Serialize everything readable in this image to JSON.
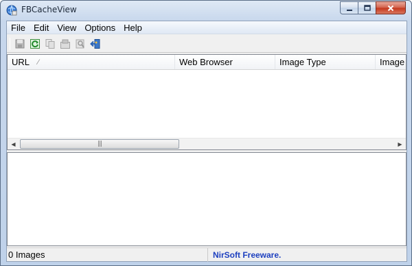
{
  "window": {
    "title": "FBCacheView",
    "icon": "app-globe-icon",
    "controls": {
      "minimize": "minimize-icon",
      "maximize": "maximize-icon",
      "close": "close-icon"
    }
  },
  "menu": {
    "items": [
      {
        "label": "File"
      },
      {
        "label": "Edit"
      },
      {
        "label": "View"
      },
      {
        "label": "Options"
      },
      {
        "label": "Help"
      }
    ]
  },
  "toolbar": {
    "buttons": [
      {
        "icon": "save-icon",
        "enabled": false
      },
      {
        "icon": "refresh-icon",
        "enabled": true
      },
      {
        "icon": "copy-icon",
        "enabled": false
      },
      {
        "icon": "properties-icon",
        "enabled": false
      },
      {
        "icon": "find-icon",
        "enabled": false
      },
      {
        "icon": "exit-icon",
        "enabled": true
      }
    ]
  },
  "list": {
    "columns": [
      {
        "label": "URL",
        "sorted": true
      },
      {
        "label": "Web Browser"
      },
      {
        "label": "Image Type"
      },
      {
        "label": "Image"
      }
    ],
    "rows": []
  },
  "status": {
    "count": "0 Images",
    "link": "NirSoft Freeware."
  },
  "colors": {
    "link": "#1c3fbf",
    "close_button": "#c4351c"
  }
}
